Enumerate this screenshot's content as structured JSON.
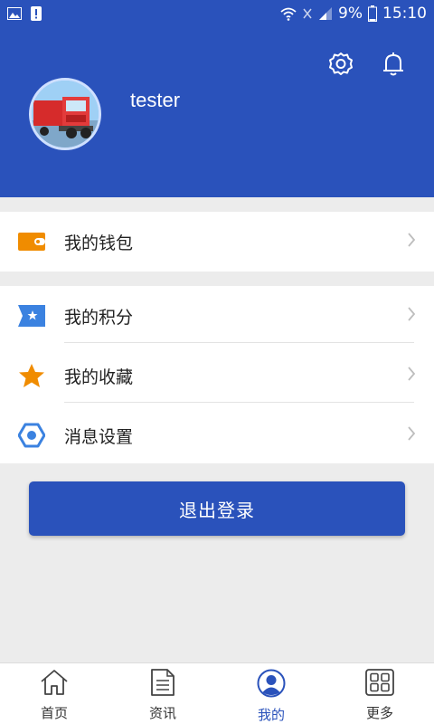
{
  "status_bar": {
    "battery": "9%",
    "time": "15:10"
  },
  "header": {
    "username": "tester"
  },
  "menu": {
    "wallet": {
      "label": "我的钱包",
      "icon": "wallet-icon",
      "color": "#f08c00"
    },
    "points": {
      "label": "我的积分",
      "icon": "points-tag-icon",
      "color": "#3b82e0"
    },
    "favorites": {
      "label": "我的收藏",
      "icon": "star-icon",
      "color": "#f08c00"
    },
    "message_settings": {
      "label": "消息设置",
      "icon": "hexagon-settings-icon",
      "color": "#3b82e0"
    }
  },
  "logout": {
    "label": "退出登录"
  },
  "bottom_nav": [
    {
      "label": "首页",
      "icon": "home-icon"
    },
    {
      "label": "资讯",
      "icon": "news-icon"
    },
    {
      "label": "我的",
      "icon": "profile-icon",
      "active": true
    },
    {
      "label": "更多",
      "icon": "grid-icon"
    }
  ],
  "colors": {
    "primary": "#2a52bb",
    "accent_orange": "#f08c00",
    "accent_blue": "#3b82e0"
  }
}
